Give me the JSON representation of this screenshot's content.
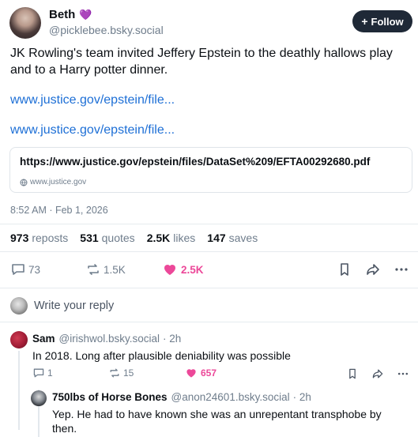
{
  "post": {
    "author": {
      "name": "Beth",
      "badge": "💜",
      "handle": "@picklebee.bsky.social"
    },
    "follow_button": "Follow",
    "text": "JK Rowling's team invited Jeffery Epstein to the deathly hallows play and to a Harry potter dinner.",
    "links": [
      "www.justice.gov/epstein/file...",
      "www.justice.gov/epstein/file..."
    ],
    "card": {
      "title": "https://www.justice.gov/epstein/files/DataSet%209/EFTA00292680.pdf",
      "domain": "www.justice.gov"
    },
    "timestamp": "8:52 AM · Feb 1, 2026",
    "stats": {
      "reposts_count": "973",
      "reposts_label": "reposts",
      "quotes_count": "531",
      "quotes_label": "quotes",
      "likes_count": "2.5K",
      "likes_label": "likes",
      "saves_count": "147",
      "saves_label": "saves"
    },
    "actions": {
      "replies": "73",
      "reposts": "1.5K",
      "likes": "2.5K"
    }
  },
  "reply_composer": {
    "placeholder": "Write your reply"
  },
  "replies": [
    {
      "name": "Sam",
      "handle": "@irishwol.bsky.social",
      "time": "· 2h",
      "text": "In 2018. Long after plausible deniability was possible",
      "actions": {
        "replies": "1",
        "reposts": "15",
        "likes": "657"
      }
    },
    {
      "name": "750lbs of Horse Bones",
      "handle": "@anon24601.bsky.social",
      "time": "· 2h",
      "text": "Yep. He had to have known she was an unrepentant transphobe by then."
    }
  ],
  "colors": {
    "link": "#1d6fd6",
    "like": "#ec4899",
    "muted": "#6f7d8c",
    "follow_bg": "#1f2937"
  }
}
